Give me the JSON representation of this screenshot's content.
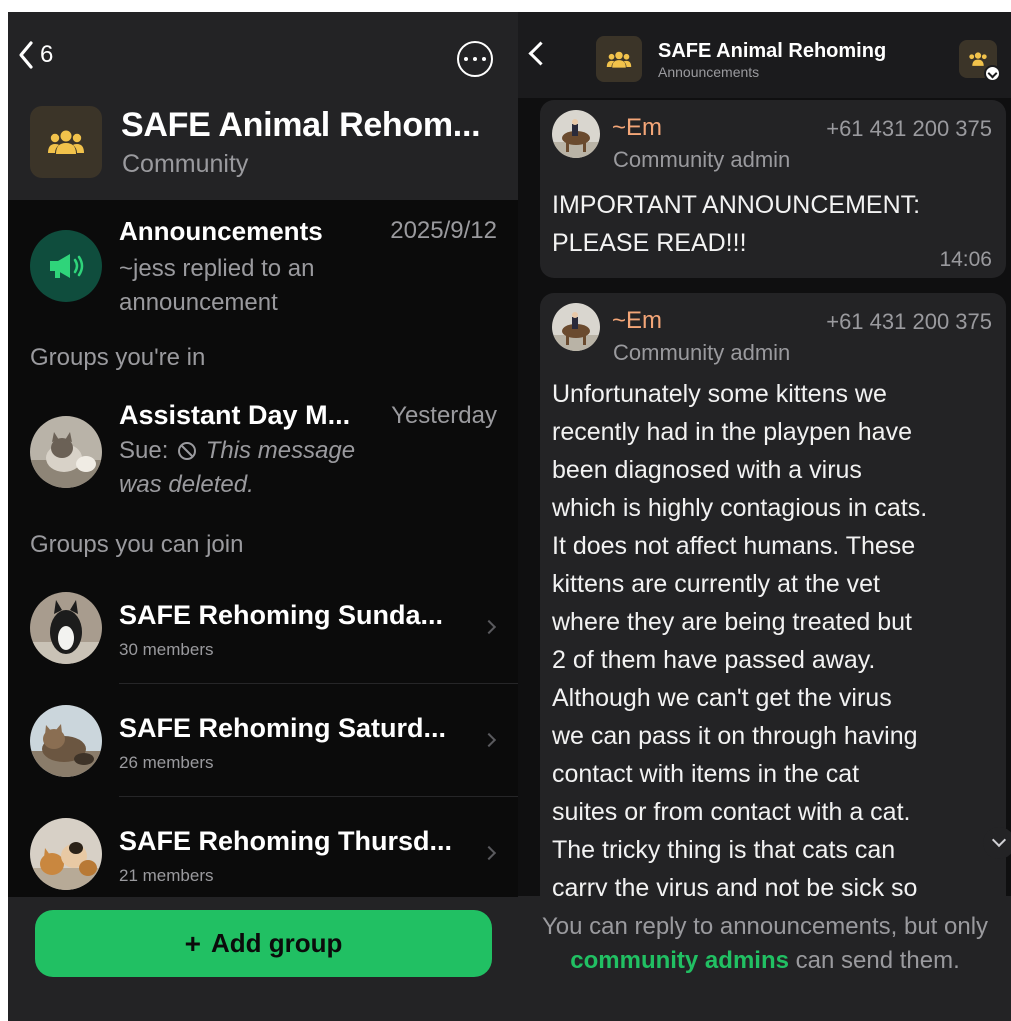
{
  "left": {
    "back_count": "6",
    "community": {
      "title": "SAFE Animal Rehom...",
      "subtitle": "Community"
    },
    "announcements": {
      "name": "Announcements",
      "date": "2025/9/12",
      "preview": "~jess replied to an announcement"
    },
    "sections": {
      "in": "Groups you're in",
      "join": "Groups you can join"
    },
    "my_group": {
      "name": "Assistant Day M...",
      "time": "Yesterday",
      "sender": "Sue:",
      "deleted_text": "This message was deleted."
    },
    "joinable_groups": [
      {
        "name": "SAFE Rehoming Sunda...",
        "members": "30 members"
      },
      {
        "name": "SAFE Rehoming Saturd...",
        "members": "26 members"
      },
      {
        "name": "SAFE Rehoming Thursd...",
        "members": "21 members"
      }
    ],
    "add_group_label": "Add group"
  },
  "right": {
    "title": "SAFE Animal Rehoming",
    "subtitle": "Announcements",
    "messages": [
      {
        "sender": "~Em",
        "phone": "+61 431 200 375",
        "role": "Community admin",
        "text": "IMPORTANT ANNOUNCEMENT: PLEASE READ!!!",
        "time": "14:06"
      },
      {
        "sender": "~Em",
        "phone": "+61 431 200 375",
        "role": "Community admin",
        "lines": [
          "Unfortunately some kittens we",
          "recently had in the playpen have",
          "been diagnosed with a virus",
          "which is highly contagious in cats.",
          "It does not affect humans. These",
          "kittens are currently at the vet",
          "where they are being treated but",
          "2 of them have passed away.",
          "Although we can't get the virus",
          "we can pass it on through having",
          "contact with items in the cat",
          "suites or from contact with a cat.",
          "The tricky thing is that cats can",
          "carry the virus and not be sick so"
        ]
      }
    ],
    "notice": {
      "before": "You can reply to announcements, but only",
      "link": "community admins",
      "after": "can send them."
    }
  },
  "colors": {
    "accent_green": "#21c063",
    "sender_name": "#f4a678",
    "community_icon": "#f1c24b",
    "panel_bg": "#0b0b0b",
    "header_bg": "#232325"
  },
  "icons": [
    "chevron-left-icon",
    "more-icon",
    "community-icon",
    "megaphone-icon",
    "blocked-icon",
    "chevron-right-icon",
    "chevron-down-icon",
    "plus-icon"
  ]
}
